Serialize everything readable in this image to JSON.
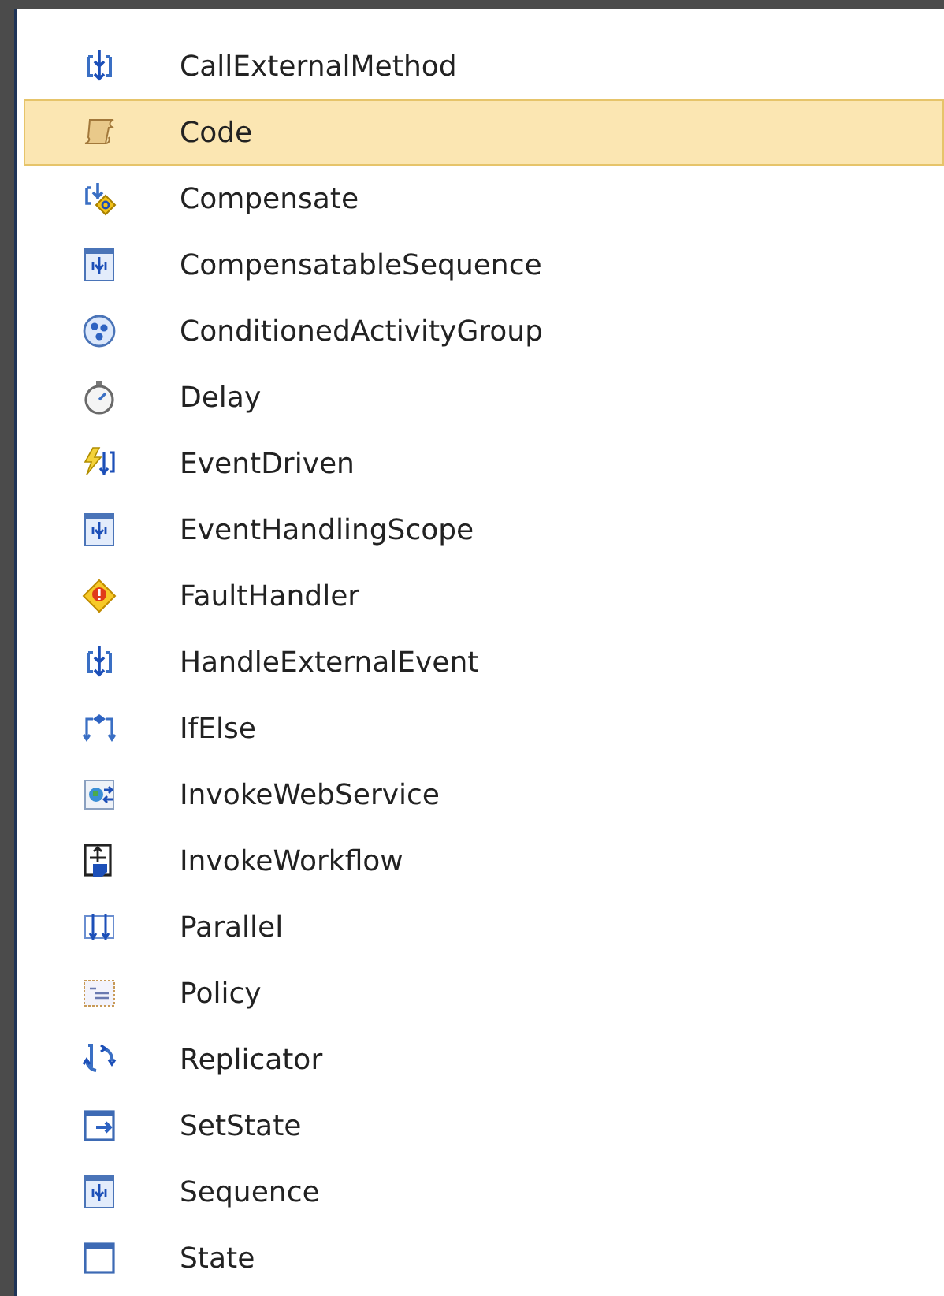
{
  "toolbox": {
    "items": [
      {
        "label": "CallExternalMethod",
        "kind": "activity",
        "selected": false
      },
      {
        "label": "Code",
        "kind": "scroll",
        "selected": true
      },
      {
        "label": "Compensate",
        "kind": "compensate",
        "selected": false
      },
      {
        "label": "CompensatableSequence",
        "kind": "sequence",
        "selected": false
      },
      {
        "label": "ConditionedActivityGroup",
        "kind": "group",
        "selected": false
      },
      {
        "label": "Delay",
        "kind": "stopwatch",
        "selected": false
      },
      {
        "label": "EventDriven",
        "kind": "event",
        "selected": false
      },
      {
        "label": "EventHandlingScope",
        "kind": "sequence",
        "selected": false
      },
      {
        "label": "FaultHandler",
        "kind": "fault",
        "selected": false
      },
      {
        "label": "HandleExternalEvent",
        "kind": "activity",
        "selected": false
      },
      {
        "label": "IfElse",
        "kind": "branch",
        "selected": false
      },
      {
        "label": "InvokeWebService",
        "kind": "web",
        "selected": false
      },
      {
        "label": "InvokeWorkflow",
        "kind": "workflow",
        "selected": false
      },
      {
        "label": "Parallel",
        "kind": "parallel",
        "selected": false
      },
      {
        "label": "Policy",
        "kind": "policy",
        "selected": false
      },
      {
        "label": "Replicator",
        "kind": "replicator",
        "selected": false
      },
      {
        "label": "SetState",
        "kind": "setstate",
        "selected": false
      },
      {
        "label": "Sequence",
        "kind": "sequence",
        "selected": false
      },
      {
        "label": "State",
        "kind": "state",
        "selected": false
      }
    ]
  }
}
